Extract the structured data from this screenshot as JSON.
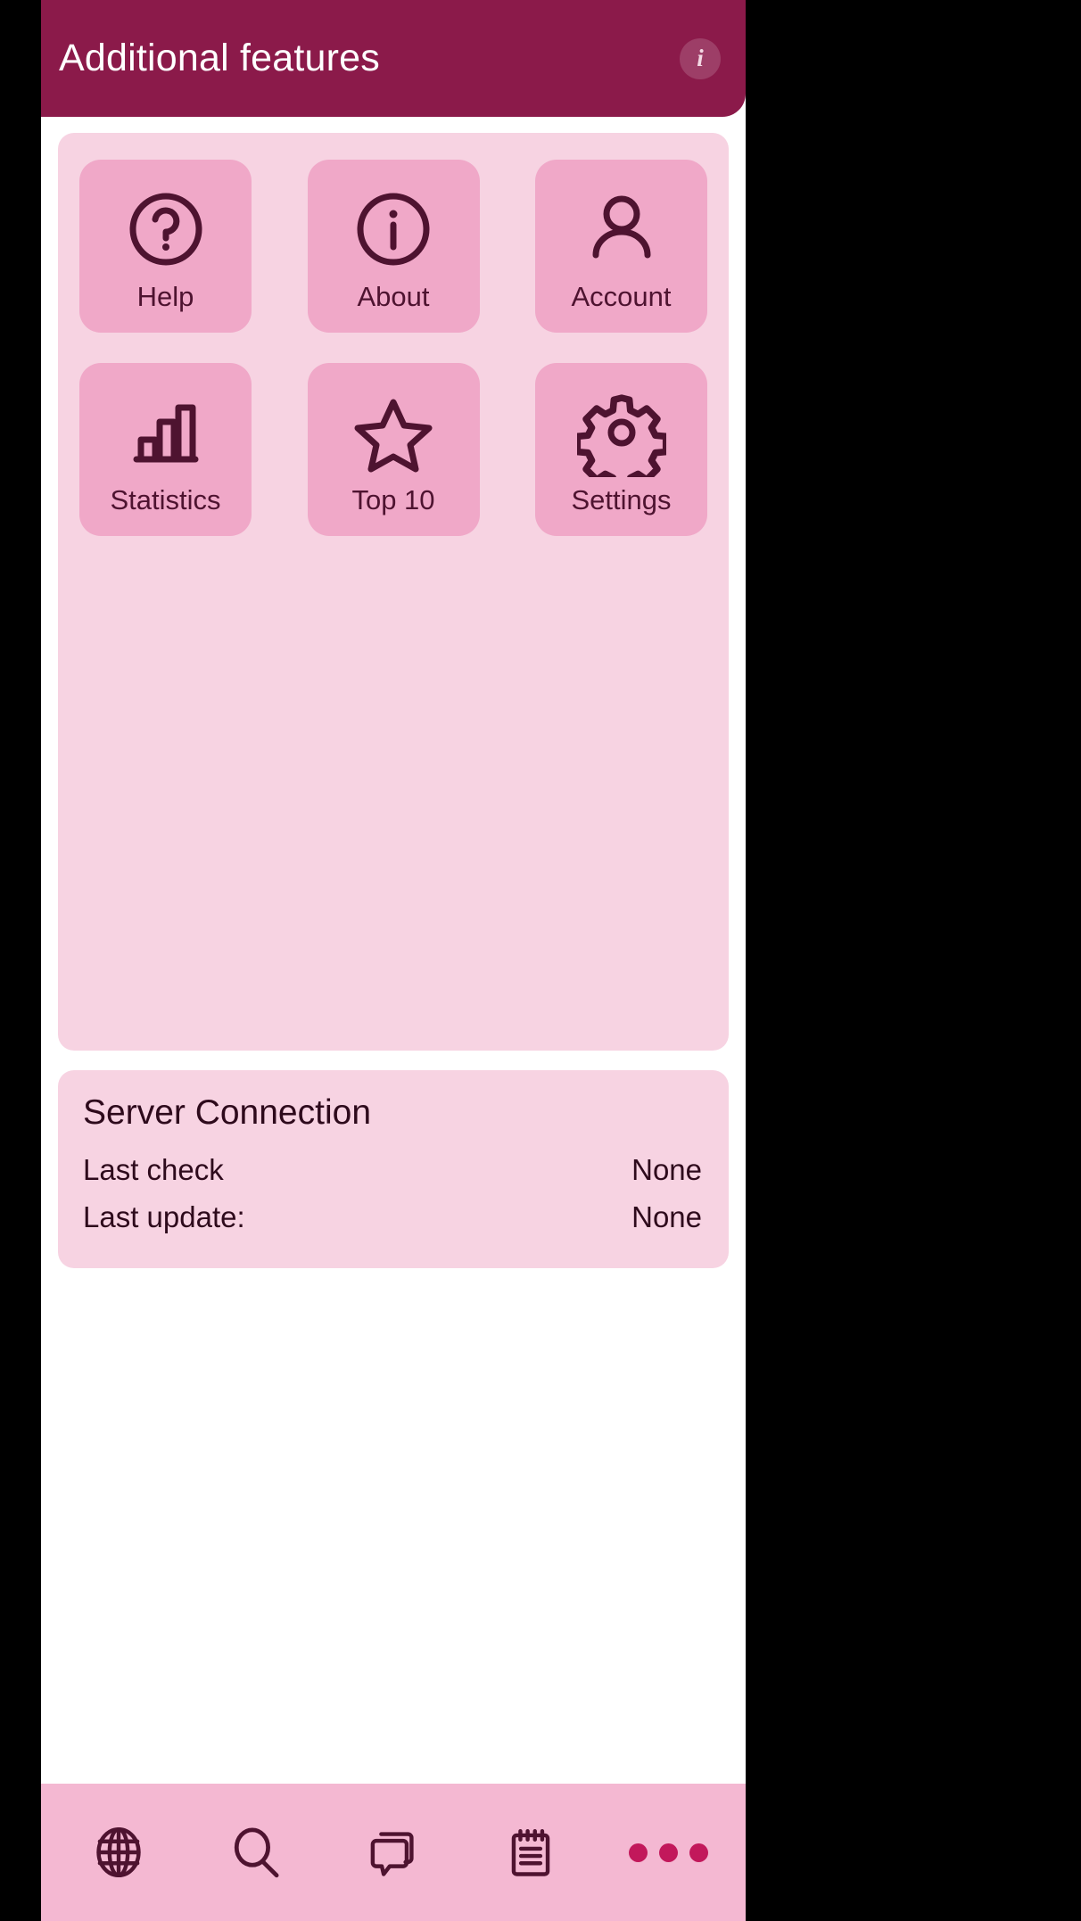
{
  "appbar": {
    "title": "Additional features",
    "info_icon": "info-circle-icon",
    "info_glyph": "i",
    "bg_color": "#8B1A4A",
    "title_color": "#FFFFFF"
  },
  "theme": {
    "accent": "#8B1A4A",
    "card_bg": "#F7D3E2",
    "tile_bg": "#F0A8C8",
    "icon_color": "#4E1330",
    "nav_bg": "#F4B8D2",
    "text_color": "#2E0A1C"
  },
  "grid": {
    "rows": [
      [
        {
          "label": "Help",
          "icon": "question-mark-circle-icon"
        },
        {
          "label": "About",
          "icon": "info-circle-icon"
        },
        {
          "label": "Account",
          "icon": "person-icon"
        }
      ],
      [
        {
          "label": "Statistics",
          "icon": "bar-chart-icon"
        },
        {
          "label": "Top 10",
          "icon": "star-outline-icon"
        },
        {
          "label": "Settings",
          "icon": "gear-icon"
        }
      ]
    ]
  },
  "server": {
    "title": "Server Connection",
    "rows": [
      {
        "key": "Last check",
        "value": "None"
      },
      {
        "key": "Last update:",
        "value": "None"
      }
    ]
  },
  "bottom_nav": {
    "items": [
      {
        "icon": "globe-icon"
      },
      {
        "icon": "search-icon"
      },
      {
        "icon": "chat-bubbles-icon"
      },
      {
        "icon": "notepad-icon"
      },
      {
        "icon": "more-dots-icon"
      }
    ]
  }
}
